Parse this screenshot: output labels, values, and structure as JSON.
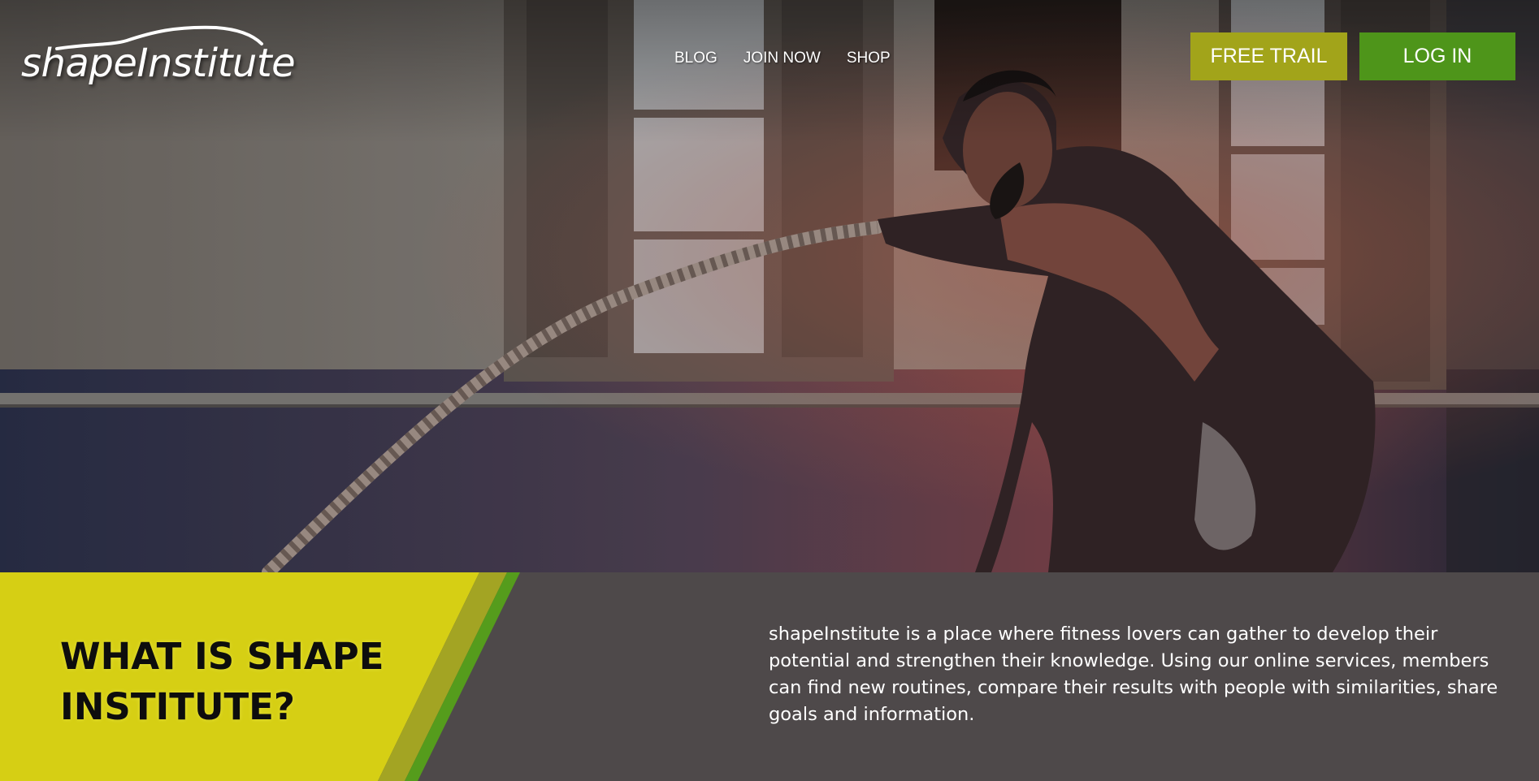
{
  "brand": {
    "name": "shapeInstitute"
  },
  "nav": {
    "items": [
      {
        "label": "BLOG"
      },
      {
        "label": "JOIN NOW"
      },
      {
        "label": "SHOP"
      }
    ]
  },
  "header_buttons": {
    "free_trial": "FREE TRAIL",
    "login": "LOG IN"
  },
  "about": {
    "title": "WHAT IS SHAPE INSTITUTE?",
    "description": "shapeInstitute is a place where fitness lovers can gather to develop their potential and strengthen their knowledge. Using our online services, members can find new routines, compare their results with people with similarities, share goals and information."
  },
  "colors": {
    "free_trial_button": "#a2a41a",
    "login_button": "#4e951a",
    "section_background": "#4e494a",
    "accent_yellow": "#d6cf14",
    "accent_green": "#559c1c"
  }
}
